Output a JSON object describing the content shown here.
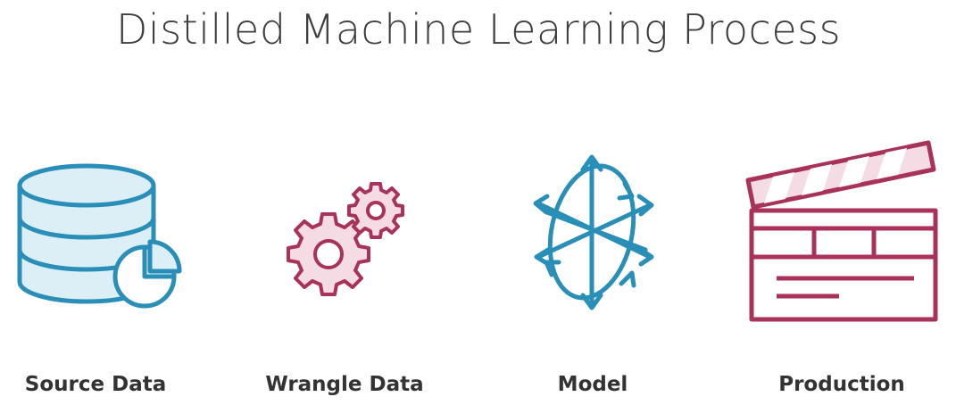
{
  "title": "Distilled Machine Learning Process",
  "steps": [
    {
      "label": "Source Data",
      "icon": "database-pie-chart-icon"
    },
    {
      "label": "Wrangle Data",
      "icon": "gears-icon"
    },
    {
      "label": "Model",
      "icon": "orbit-arrows-icon"
    },
    {
      "label": "Production",
      "icon": "clapperboard-icon"
    }
  ],
  "colors": {
    "blue": "#2a8fb8",
    "blue_fill": "#dceff6",
    "maroon": "#a8325a",
    "maroon_fill": "#f5dbe3",
    "text": "#333333"
  }
}
